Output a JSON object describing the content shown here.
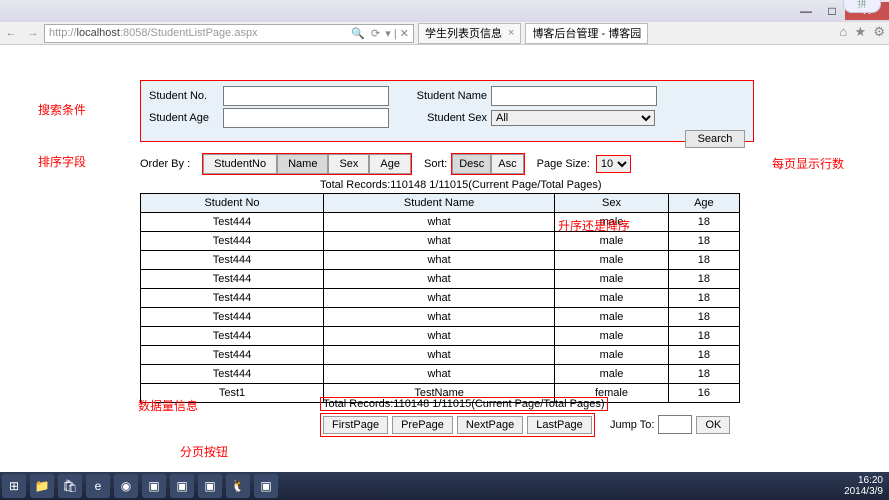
{
  "window": {
    "min": "—",
    "max": "□",
    "close": "✕"
  },
  "browser": {
    "url_grey": "http://",
    "url_host": "localhost",
    "url_rest": ":8058/StudentListPage.aspx",
    "tabs": [
      {
        "label": "学生列表页信息",
        "selected": true
      },
      {
        "label": "博客后台管理 - 博客园",
        "selected": false
      }
    ]
  },
  "search": {
    "no_label": "Student No.",
    "name_label": "Student Name",
    "age_label": "Student Age",
    "sex_label": "Student Sex",
    "sex_value": "All",
    "button": "Search"
  },
  "order": {
    "label": "Order By :",
    "buttons": [
      "StudentNo",
      "Name",
      "Sex",
      "Age"
    ],
    "selected": 1
  },
  "sort": {
    "label": "Sort:",
    "buttons": [
      "Desc",
      "Asc"
    ],
    "selected": 0
  },
  "pagesize": {
    "label": "Page Size:",
    "value": "10"
  },
  "records": {
    "top": "Total Records:110148     1/11015(Current Page/Total Pages)",
    "bottom": "Total Records:110148     1/11015(Current Page/Total Pages)"
  },
  "grid": {
    "headers": [
      "Student No",
      "Student Name",
      "Sex",
      "Age"
    ],
    "rows": [
      [
        "Test444",
        "what",
        "male",
        "18"
      ],
      [
        "Test444",
        "what",
        "male",
        "18"
      ],
      [
        "Test444",
        "what",
        "male",
        "18"
      ],
      [
        "Test444",
        "what",
        "male",
        "18"
      ],
      [
        "Test444",
        "what",
        "male",
        "18"
      ],
      [
        "Test444",
        "what",
        "male",
        "18"
      ],
      [
        "Test444",
        "what",
        "male",
        "18"
      ],
      [
        "Test444",
        "what",
        "male",
        "18"
      ],
      [
        "Test444",
        "what",
        "male",
        "18"
      ],
      [
        "Test1",
        "TestName",
        "female",
        "16"
      ]
    ]
  },
  "pager": {
    "buttons": [
      "FirstPage",
      "PrePage",
      "NextPage",
      "LastPage"
    ]
  },
  "jump": {
    "label": "Jump To:",
    "ok": "OK"
  },
  "annotations": {
    "a1": "搜索条件",
    "a2": "排序字段",
    "a3": "升序还是降序",
    "a4": "每页显示行数",
    "a5": "数据量信息",
    "a6": "分页按钮"
  },
  "taskbar": {
    "time": "16:20",
    "date": "2014/3/9"
  }
}
